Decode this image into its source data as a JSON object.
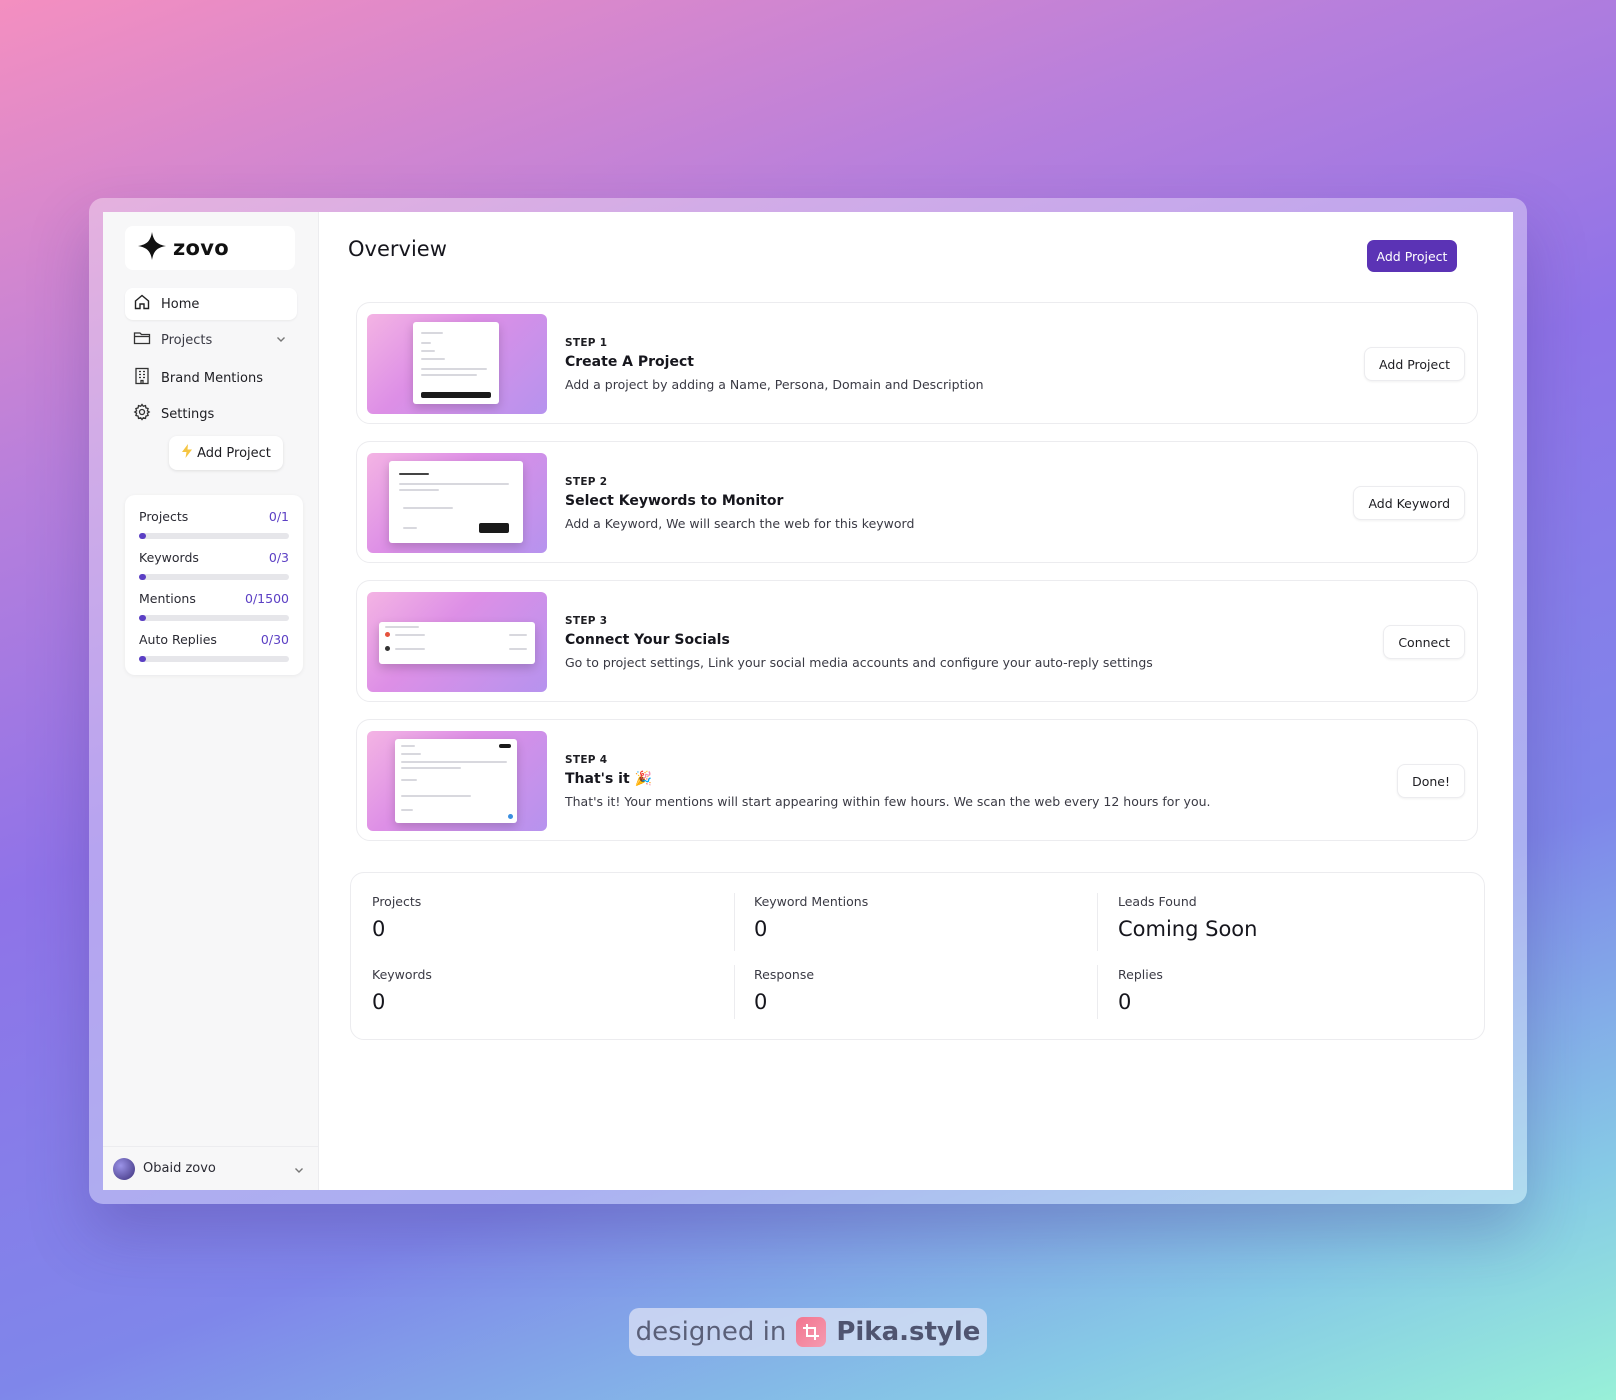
{
  "app": {
    "name": "zovo"
  },
  "sidebar": {
    "nav": [
      {
        "label": "Home",
        "icon": "home-icon",
        "active": true
      },
      {
        "label": "Projects",
        "icon": "folder-icon",
        "has_chevron": true
      },
      {
        "label": "Brand Mentions",
        "icon": "building-icon"
      },
      {
        "label": "Settings",
        "icon": "gear-icon"
      }
    ],
    "add_project_label": "Add Project",
    "usage": [
      {
        "label": "Projects",
        "value": "0/1"
      },
      {
        "label": "Keywords",
        "value": "0/3"
      },
      {
        "label": "Mentions",
        "value": "0/1500"
      },
      {
        "label": "Auto Replies",
        "value": "0/30"
      }
    ],
    "user_name": "Obaid zovo"
  },
  "header": {
    "title": "Overview",
    "add_project_label": "Add Project"
  },
  "steps": [
    {
      "step": "STEP 1",
      "title": "Create A Project",
      "description": "Add a project by adding a Name, Persona, Domain and Description",
      "button": "Add Project"
    },
    {
      "step": "STEP 2",
      "title": "Select Keywords to Monitor",
      "description": "Add a Keyword, We will search the web for this keyword",
      "button": "Add Keyword"
    },
    {
      "step": "STEP 3",
      "title": "Connect Your Socials",
      "description": "Go to project settings, Link your social media accounts and configure your auto-reply settings",
      "button": "Connect"
    },
    {
      "step": "STEP 4",
      "title": "That's it 🎉",
      "description": "That's it! Your mentions will start appearing within few hours. We scan the web every 12 hours for you.",
      "button": "Done!"
    }
  ],
  "stats": [
    {
      "label": "Projects",
      "value": "0"
    },
    {
      "label": "Keyword Mentions",
      "value": "0"
    },
    {
      "label": "Leads Found",
      "value": "Coming Soon"
    },
    {
      "label": "Keywords",
      "value": "0"
    },
    {
      "label": "Response",
      "value": "0"
    },
    {
      "label": "Replies",
      "value": "0"
    }
  ],
  "footer_badge": {
    "prefix": "designed in",
    "brand": "Pika.style"
  },
  "colors": {
    "accent": "#5b33b5",
    "progress": "#5b3fc4"
  }
}
